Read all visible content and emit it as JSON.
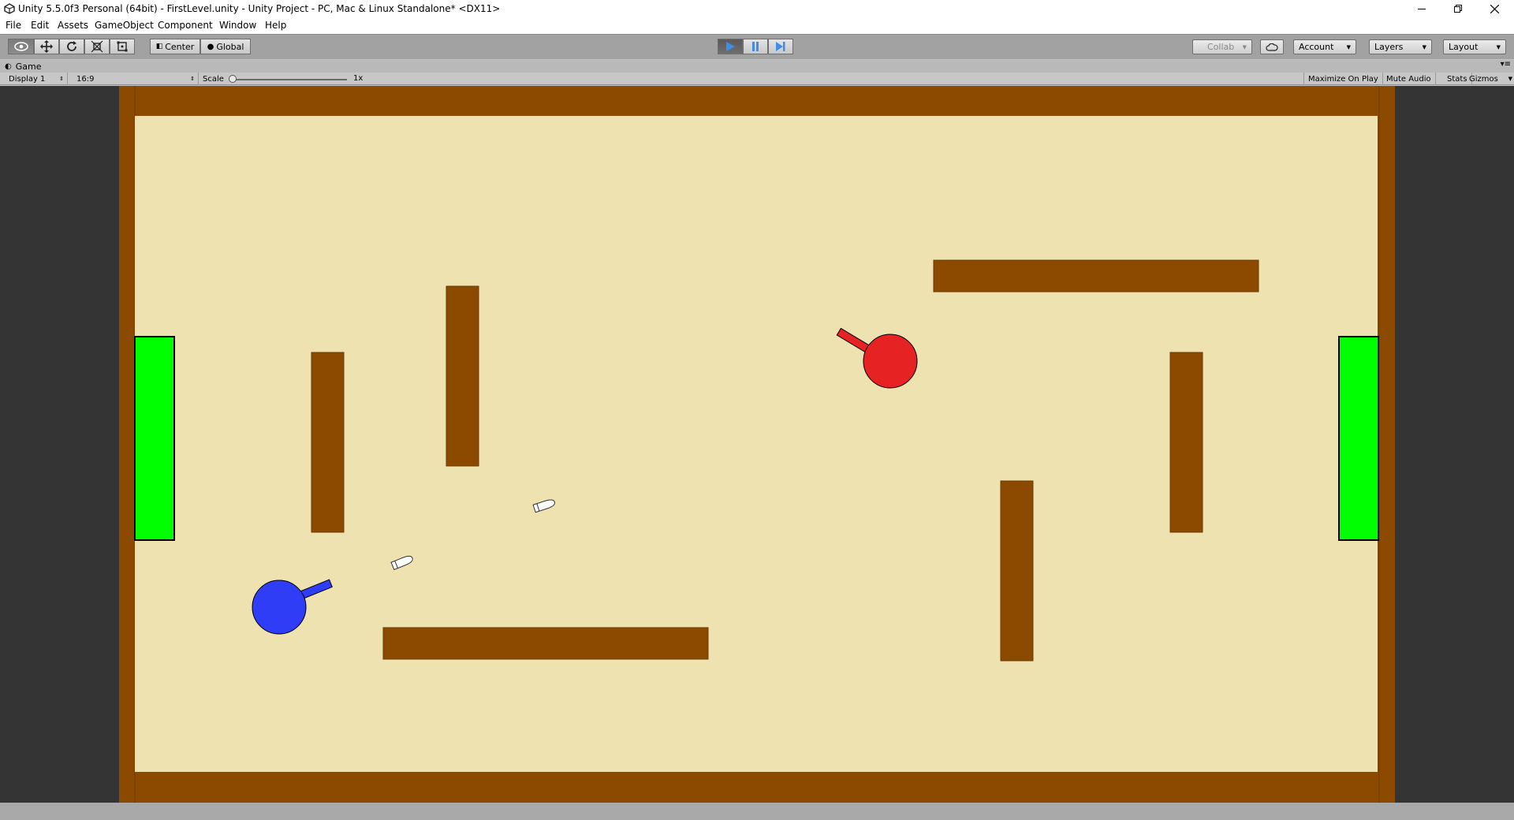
{
  "window": {
    "title": "Unity 5.5.0f3 Personal (64bit) - FirstLevel.unity - Unity Project - PC, Mac & Linux Standalone* <DX11>",
    "minimize_icon": "minimize-icon",
    "restore_icon": "restore-icon",
    "close_icon": "close-icon"
  },
  "menu": [
    "File",
    "Edit",
    "Assets",
    "GameObject",
    "Component",
    "Window",
    "Help"
  ],
  "toolbar": {
    "tools": [
      "view-hand-icon",
      "move-icon",
      "rotate-icon",
      "scale-icon",
      "rect-tool-icon"
    ],
    "pivot_label": "Center",
    "space_label": "Global",
    "play_icon": "play-icon",
    "pause_icon": "pause-icon",
    "step_icon": "step-icon",
    "collab_label": "Collab",
    "cloud_icon": "cloud-icon",
    "account_label": "Account",
    "layers_label": "Layers",
    "layout_label": "Layout"
  },
  "game_panel": {
    "tab_label": "Game",
    "display_label": "Display 1",
    "aspect_label": "16:9",
    "scale_label": "Scale",
    "scale_value_label": "1x",
    "scale_fraction": 0.0,
    "maximize_label": "Maximize On Play",
    "mute_label": "Mute Audio",
    "stats_label": "Stats",
    "gizmos_label": "Gizmos"
  },
  "colors": {
    "border_wall": "#8b4a00",
    "field": "#ede2b0",
    "goal": "#00ff00",
    "blue_tank": "#2f3df7",
    "red_tank": "#e62222",
    "bullet": "#ffffff",
    "editor_bg": "#343434",
    "toolbar_bg": "#a2a2a2",
    "play_active": "#3e8ee8"
  }
}
